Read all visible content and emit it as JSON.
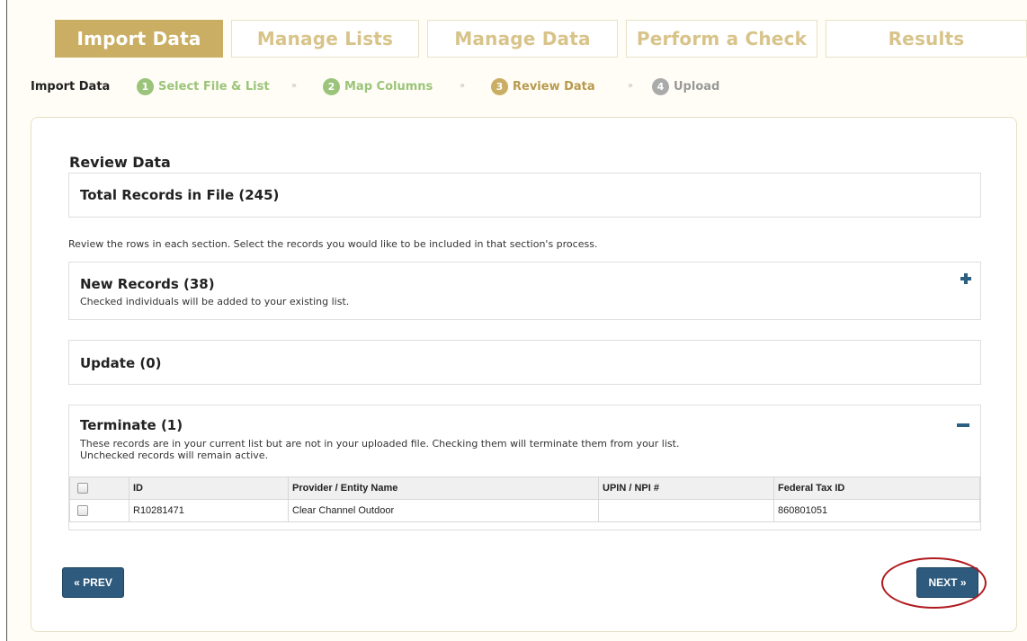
{
  "tabs": [
    {
      "label": "Import Data",
      "active": true
    },
    {
      "label": "Manage Lists",
      "active": false
    },
    {
      "label": "Manage Data",
      "active": false
    },
    {
      "label": "Perform a Check",
      "active": false
    },
    {
      "label": "Results",
      "active": false
    }
  ],
  "steps": {
    "lead": "Import Data",
    "separator": "»",
    "items": [
      {
        "num": "1",
        "label": "Select File & List",
        "state": "done",
        "color": "#9bc47a"
      },
      {
        "num": "2",
        "label": "Map Columns",
        "state": "done",
        "color": "#9bc47a"
      },
      {
        "num": "3",
        "label": "Review Data",
        "state": "current",
        "color": "#c9ae63"
      },
      {
        "num": "4",
        "label": "Upload",
        "state": "pending",
        "color": "#aaaaaa"
      }
    ]
  },
  "review": {
    "title": "Review Data",
    "total": "Total Records in File (245)",
    "instructions": "Review the rows in each section. Select the records you would like to be included in that section's process.",
    "new_records": {
      "title": "New Records (38)",
      "desc": "Checked individuals will be added to your existing list.",
      "icon": "plus-icon"
    },
    "update": {
      "title": "Update (0)"
    },
    "terminate": {
      "title": "Terminate (1)",
      "desc1": "These records are in your current list but are not in your uploaded file. Checking them will terminate them from your list.",
      "desc2": "Unchecked records will remain active.",
      "icon": "minus-icon",
      "columns": [
        "ID",
        "Provider / Entity Name",
        "UPIN / NPI #",
        "Federal Tax ID"
      ],
      "rows": [
        {
          "id": "R10281471",
          "name": "Clear Channel Outdoor",
          "upin": "",
          "tax_id": "860801051",
          "checked": false
        }
      ]
    }
  },
  "nav": {
    "prev_label": "« PREV",
    "next_label": "NEXT »"
  },
  "colors": {
    "accent": "#c9ae63",
    "button": "#2d5a7d",
    "highlight": "#b0191e"
  }
}
